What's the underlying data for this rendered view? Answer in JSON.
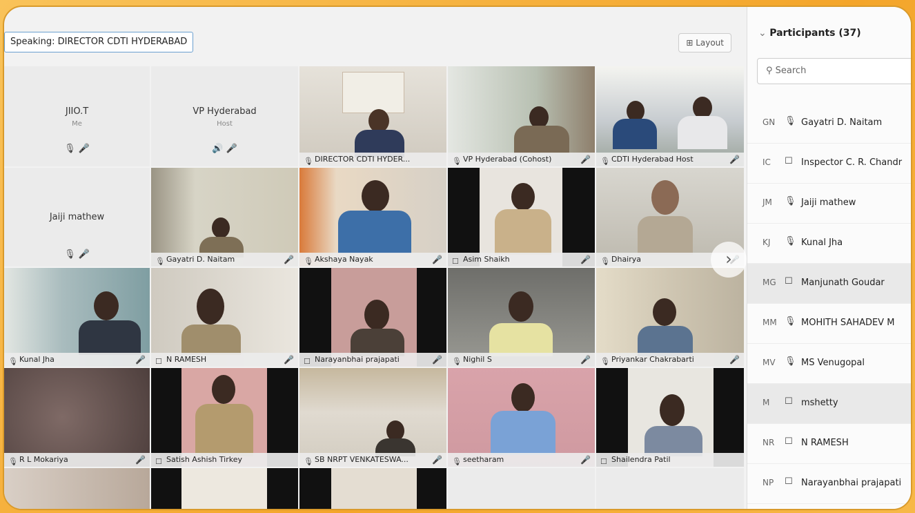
{
  "speaking_label": "Speaking: DIRECTOR CDTI HYDERABAD",
  "layout_label": "Layout",
  "participants": {
    "title": "Participants (37)",
    "search_placeholder": "Search",
    "items": [
      {
        "initials": "GN",
        "name": "Gayatri D. Naitam",
        "icon": "mic-icon"
      },
      {
        "initials": "IC",
        "name": "Inspector C. R. Chandr",
        "icon": "phone-icon"
      },
      {
        "initials": "JM",
        "name": "Jaiji mathew",
        "icon": "mic-icon"
      },
      {
        "initials": "KJ",
        "name": "Kunal Jha",
        "icon": "mic-icon"
      },
      {
        "initials": "MG",
        "name": "Manjunath Goudar",
        "icon": "phone-icon"
      },
      {
        "initials": "MM",
        "name": "MOHITH SAHADEV M",
        "icon": "mic-icon"
      },
      {
        "initials": "MV",
        "name": "MS Venugopal",
        "icon": "mic-icon"
      },
      {
        "initials": "M",
        "name": "mshetty",
        "icon": "phone-icon"
      },
      {
        "initials": "NR",
        "name": "N RAMESH",
        "icon": "phone-icon"
      },
      {
        "initials": "NP",
        "name": "Narayanbhai prajapati",
        "icon": "phone-icon"
      }
    ]
  },
  "tiles": {
    "jio": {
      "name": "JIIO.T",
      "sub": "Me"
    },
    "vp": {
      "name": "VP Hyderabad",
      "sub": "Host"
    },
    "jaiji": {
      "name": "Jaiji mathew"
    },
    "director": "DIRECTOR CDTI HYDER...",
    "vp_video": "VP Hyderabad (Cohost)",
    "cdti_host": "CDTI Hyderabad Host",
    "gayatri": "Gayatri D. Naitam",
    "akshaya": "Akshaya Nayak",
    "asim": "Asim Shaikh",
    "dhairya": "Dhairya",
    "kunal": "Kunal Jha",
    "nramesh": "N RAMESH",
    "narayanbhai": "Narayanbhai prajapati",
    "nighil": "Nighil S",
    "priyankar": "Priyankar Chakrabarti",
    "rl": "R L Mokariya",
    "satish": "Satish Ashish Tirkey",
    "sb": "SB NRPT VENKATESWA...",
    "seetharam": "seetharam",
    "shailendra": "Shailendra Patil"
  }
}
